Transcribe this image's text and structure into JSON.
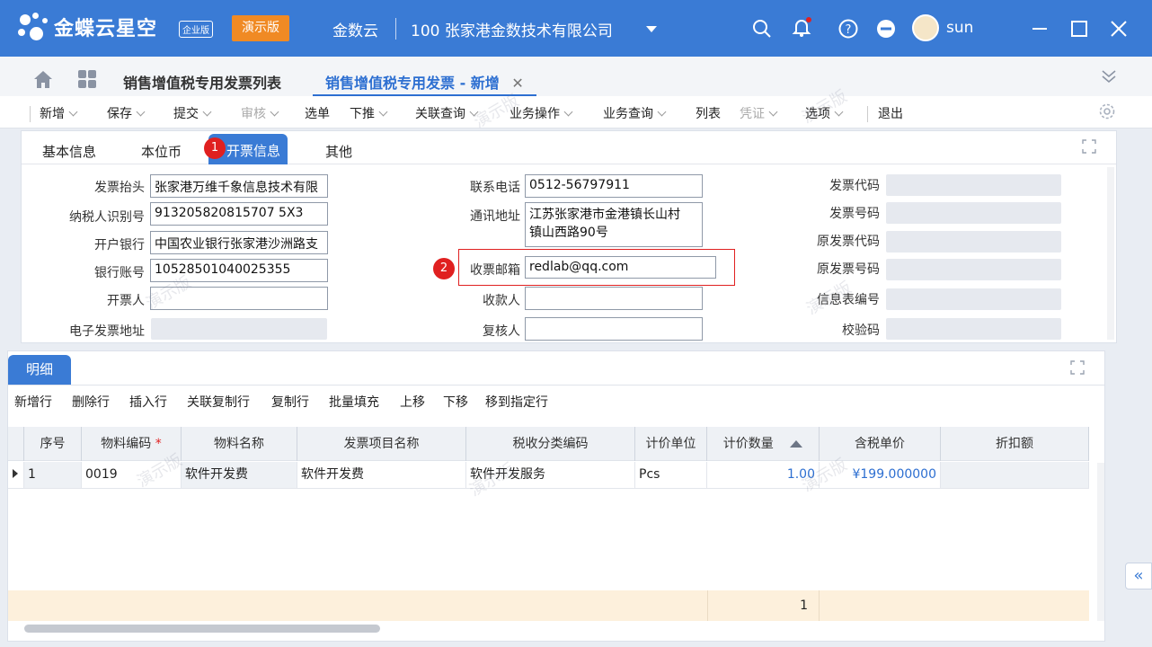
{
  "app": {
    "brand": "金蝶云星空",
    "edition": "企业版",
    "demo_label": "演示版",
    "tenant": "金数云",
    "org": "100  张家港金数技术有限公司",
    "user": "sun",
    "accent": "#3a7bd5"
  },
  "tabs": {
    "list_tab": "销售增值税专用发票列表",
    "active_tab": "销售增值税专用发票 - 新增"
  },
  "toolbar": {
    "new": "新增",
    "save": "保存",
    "submit": "提交",
    "audit": "审核",
    "select_bill": "选单",
    "push": "下推",
    "related_query": "关联查询",
    "biz_ops": "业务操作",
    "biz_query": "业务查询",
    "list": "列表",
    "voucher": "凭证",
    "options": "选项",
    "exit": "退出"
  },
  "form_tabs": {
    "basic": "基本信息",
    "currency": "本位币",
    "invoice_info": "开票信息",
    "other": "其他",
    "step1": "1",
    "step2": "2"
  },
  "form": {
    "invoice_title_label": "发票抬头",
    "invoice_title": "张家港万维千象信息技术有限",
    "taxpayer_id_label": "纳税人识别号",
    "taxpayer_id": "913205820815707 5X3",
    "bank_label": "开户银行",
    "bank": "中国农业银行张家港沙洲路支",
    "account_label": "银行账号",
    "account": "10528501040025355",
    "drawer_label": "开票人",
    "drawer": "",
    "e_invoice_addr_label": "电子发票地址",
    "phone_label": "联系电话",
    "phone": "0512-56797911",
    "address_label": "通讯地址",
    "address_line1": "江苏张家港市金港镇长山村",
    "address_line2": "镇山西路90号",
    "email_label": "收票邮箱",
    "email": "redlab@qq.com",
    "payee_label": "收款人",
    "payee": "",
    "reviewer_label": "复核人",
    "reviewer": "",
    "invoice_code_label": "发票代码",
    "invoice_no_label": "发票号码",
    "orig_code_label": "原发票代码",
    "orig_no_label": "原发票号码",
    "info_sheet_label": "信息表编号",
    "check_code_label": "校验码"
  },
  "detail": {
    "tab": "明细",
    "buttons": [
      "新增行",
      "删除行",
      "插入行",
      "关联复制行",
      "复制行",
      "批量填充",
      "上移",
      "下移",
      "移到指定行"
    ],
    "columns": [
      "序号",
      "物料编码",
      "物料名称",
      "发票项目名称",
      "税收分类编码",
      "计价单位",
      "计价数量",
      "含税单价",
      "折扣额"
    ],
    "required_mark": "*",
    "rows": [
      {
        "seq": "1",
        "code": "0019",
        "name": "软件开发费",
        "item_name": "软件开发费",
        "tax_code": "软件开发服务",
        "unit": "Pcs",
        "qty": "1.00",
        "price": "¥199.000000",
        "discount": ""
      }
    ],
    "sum_qty": "1"
  },
  "watermark": "演示版"
}
